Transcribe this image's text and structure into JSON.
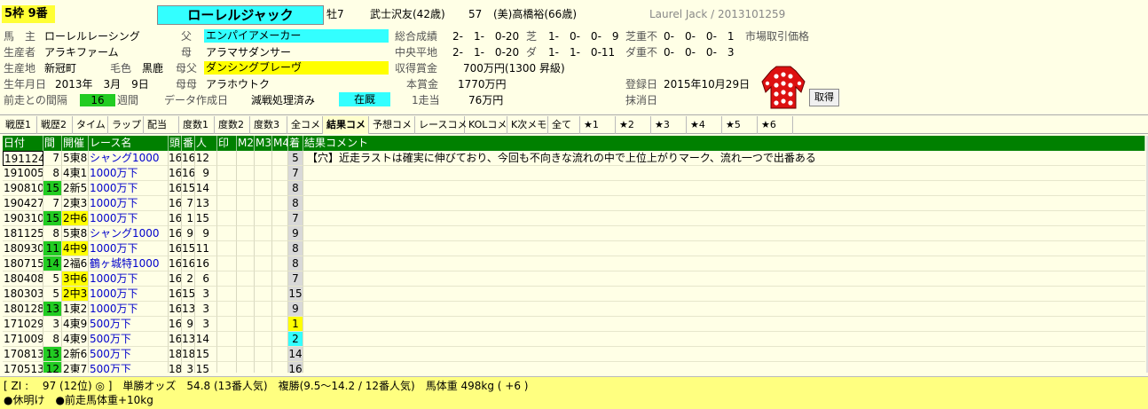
{
  "header": {
    "waku": "5枠 9番",
    "horse_name": "ローレルジャック",
    "sex_age": "牡7",
    "jockey": "武士沢友(42歳)",
    "weight": "57",
    "trainer": "(美)高橋裕(66歳)",
    "english": "Laurel Jack / 2013101259",
    "owner_label": "馬　主",
    "owner": "ローレルレーシング",
    "father_label": "父",
    "father": "エンパイアメーカー",
    "breeder_label": "生産者",
    "breeder": "アラキファーム",
    "mother_label": "母",
    "mother": "アラマサダンサー",
    "birthplace_label": "生産地",
    "birthplace": "新冠町",
    "coat_label": "毛色",
    "coat": "黒鹿",
    "dam_sire_label": "母父",
    "dam_sire": "ダンシングブレーヴ",
    "birthday_label": "生年月日",
    "birthday": "2013年　3月　9日",
    "dam_dam_label": "母母",
    "dam_dam": "アラホウトク",
    "interval_label": "前走との間隔",
    "interval_weeks": "16",
    "interval_unit": "週間",
    "data_label": "データ作成日",
    "data_status": "減戦処理済み",
    "status_badge": "在厩",
    "total_label": "総合成績",
    "total": "2-　1-　0-20",
    "turf_label": "芝",
    "turf": "1-　0-　0-　9",
    "turf_bad_label": "芝重不",
    "turf_bad": "0-　0-　0-　1",
    "market_label": "市場取引価格",
    "central_flat_label": "中央平地",
    "central_flat": "2-　1-　0-20",
    "dirt_label": "ダ",
    "dirt": "1-　1-　0-11",
    "dirt_bad_label": "ダ重不",
    "dirt_bad": "0-　0-　0-　3",
    "earn_label": "収得賞金",
    "earn": "700万円(1300 昇級)",
    "prize_label": "本賞金",
    "prize": "1770万円",
    "second_label": "1走当",
    "second": "76万円",
    "reg_label": "登録日",
    "reg_date": "2015年10月29日",
    "cancel_label": "抹消日",
    "get_button": "取得"
  },
  "tabs": [
    "戦歴1",
    "戦歴2",
    "タイム",
    "ラップ",
    "配当",
    "度数1",
    "度数2",
    "度数3",
    "全コメ",
    "結果コメ",
    "予想コメ",
    "レースコメ",
    "KOLコメ",
    "K次メモ",
    "全て",
    "★1",
    "★2",
    "★3",
    "★4",
    "★5",
    "★6"
  ],
  "active_tab": "結果コメ",
  "columns": [
    "日付",
    "間",
    "開催",
    "レース名",
    "頭",
    "番",
    "人",
    "印",
    "M2",
    "M3",
    "M4",
    "着",
    "結果コメント"
  ],
  "rows": [
    {
      "date": "191124",
      "int": "7",
      "kai": "5東8",
      "race": "シャング1000",
      "n": "16",
      "b": "16",
      "p": "12",
      "chaku": "5",
      "cmt": "【穴】近走ラストは確実に伸びており、今回も不向きな流れの中で上位上がりマーク、流れ一つで出番ある",
      "int_hl": "",
      "kai_hl": "",
      "chaku_hl": "",
      "sel": true
    },
    {
      "date": "191005",
      "int": "8",
      "kai": "4東1",
      "race": "1000万下",
      "n": "16",
      "b": "16",
      "p": "9",
      "chaku": "7",
      "cmt": "",
      "int_hl": "",
      "kai_hl": "",
      "chaku_hl": ""
    },
    {
      "date": "190810",
      "int": "15",
      "kai": "2新5",
      "race": "1000万下",
      "n": "16",
      "b": "15",
      "p": "14",
      "chaku": "8",
      "cmt": "",
      "int_hl": "green",
      "kai_hl": "",
      "chaku_hl": ""
    },
    {
      "date": "190427",
      "int": "7",
      "kai": "2東3",
      "race": "1000万下",
      "n": "16",
      "b": "7",
      "p": "13",
      "chaku": "8",
      "cmt": "",
      "int_hl": "",
      "kai_hl": "",
      "chaku_hl": ""
    },
    {
      "date": "190310",
      "int": "15",
      "kai": "2中6",
      "race": "1000万下",
      "n": "16",
      "b": "1",
      "p": "15",
      "chaku": "7",
      "cmt": "",
      "int_hl": "green",
      "kai_hl": "yellow",
      "chaku_hl": ""
    },
    {
      "date": "181125",
      "int": "8",
      "kai": "5東8",
      "race": "シャング1000",
      "n": "16",
      "b": "9",
      "p": "9",
      "chaku": "9",
      "cmt": "",
      "int_hl": "",
      "kai_hl": "",
      "chaku_hl": ""
    },
    {
      "date": "180930",
      "int": "11",
      "kai": "4中9",
      "race": "1000万下",
      "n": "16",
      "b": "15",
      "p": "11",
      "chaku": "8",
      "cmt": "",
      "int_hl": "green",
      "kai_hl": "yellow",
      "chaku_hl": ""
    },
    {
      "date": "180715",
      "int": "14",
      "kai": "2福6",
      "race": "鶴ヶ城特1000",
      "n": "16",
      "b": "16",
      "p": "16",
      "chaku": "8",
      "cmt": "",
      "int_hl": "green",
      "kai_hl": "",
      "chaku_hl": ""
    },
    {
      "date": "180408",
      "int": "5",
      "kai": "3中6",
      "race": "1000万下",
      "n": "16",
      "b": "2",
      "p": "6",
      "chaku": "7",
      "cmt": "",
      "int_hl": "",
      "kai_hl": "yellow",
      "chaku_hl": ""
    },
    {
      "date": "180303",
      "int": "5",
      "kai": "2中3",
      "race": "1000万下",
      "n": "16",
      "b": "15",
      "p": "3",
      "chaku": "15",
      "cmt": "",
      "int_hl": "",
      "kai_hl": "yellow",
      "chaku_hl": ""
    },
    {
      "date": "180128",
      "int": "13",
      "kai": "1東2",
      "race": "1000万下",
      "n": "16",
      "b": "13",
      "p": "3",
      "chaku": "9",
      "cmt": "",
      "int_hl": "green",
      "kai_hl": "",
      "chaku_hl": ""
    },
    {
      "date": "171029",
      "int": "3",
      "kai": "4東9",
      "race": "500万下",
      "n": "16",
      "b": "9",
      "p": "3",
      "chaku": "1",
      "cmt": "",
      "int_hl": "",
      "kai_hl": "",
      "chaku_hl": "yellow"
    },
    {
      "date": "171009",
      "int": "8",
      "kai": "4東9",
      "race": "500万下",
      "n": "16",
      "b": "13",
      "p": "14",
      "chaku": "2",
      "cmt": "",
      "int_hl": "",
      "kai_hl": "",
      "chaku_hl": "cyan"
    },
    {
      "date": "170813",
      "int": "13",
      "kai": "2新6",
      "race": "500万下",
      "n": "18",
      "b": "18",
      "p": "15",
      "chaku": "14",
      "cmt": "",
      "int_hl": "green",
      "kai_hl": "",
      "chaku_hl": ""
    },
    {
      "date": "170513",
      "int": "12",
      "kai": "2東7",
      "race": "500万下",
      "n": "18",
      "b": "3",
      "p": "15",
      "chaku": "16",
      "cmt": "",
      "int_hl": "green",
      "kai_hl": "",
      "chaku_hl": ""
    }
  ],
  "footer": {
    "line1": "[ ZI :　 97 (12位) ◎ ]　単勝オッズ　54.8 (13番人気)　複勝(9.5～14.2 / 12番人気)　馬体重 498kg ( +6 )",
    "line2": "●休明け　●前走馬体重+10kg"
  },
  "colors": {
    "header_green": "#008000",
    "cyan": "#33ffff",
    "yellow": "#ffff00",
    "green": "#22cc22",
    "bg": "#ffffe6",
    "silk_red": "#dd1111"
  }
}
